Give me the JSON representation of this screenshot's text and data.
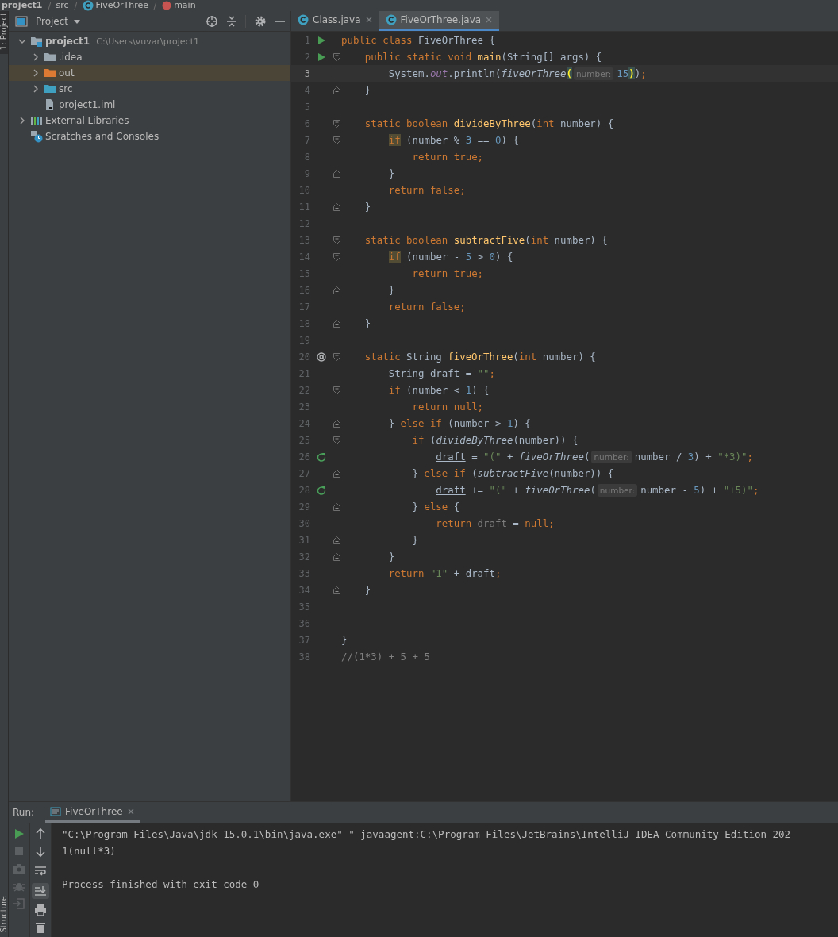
{
  "breadcrumbs": [
    {
      "label": "project1",
      "kind": "module"
    },
    {
      "label": "src",
      "kind": "folder"
    },
    {
      "label": "FiveOrThree",
      "kind": "class"
    },
    {
      "label": "main",
      "kind": "method"
    }
  ],
  "tool_strip": {
    "top": "1: Project",
    "bottom": "Structure"
  },
  "project_panel": {
    "title": "Project",
    "tools": [
      {
        "kind": "locate"
      },
      {
        "kind": "collapse"
      },
      {
        "kind": "settings"
      },
      {
        "kind": "hide"
      }
    ],
    "tree": [
      {
        "label": "project1",
        "path": "C:\\Users\\vuvar\\project1",
        "kind": "module",
        "expanded": true,
        "selected": false,
        "children": [
          {
            "label": ".idea",
            "kind": "folder",
            "expanded": false,
            "selected": false
          },
          {
            "label": "out",
            "kind": "excluded-folder",
            "expanded": false,
            "selected": true
          },
          {
            "label": "src",
            "kind": "source-folder",
            "expanded": false,
            "selected": false
          },
          {
            "label": "project1.iml",
            "kind": "module-file",
            "selected": false
          }
        ]
      },
      {
        "label": "External Libraries",
        "kind": "libraries",
        "expanded": false,
        "selected": false
      },
      {
        "label": "Scratches and Consoles",
        "kind": "scratches",
        "selected": false
      }
    ]
  },
  "editor": {
    "tabs": [
      {
        "label": "Class.java",
        "selected": false
      },
      {
        "label": "FiveOrThree.java",
        "selected": true
      }
    ],
    "lines": [
      {
        "number": "1",
        "current": false,
        "gutter_icon": {
          "kind": "run"
        },
        "tokens": [
          {
            "kind": "keyword",
            "text": "public class "
          },
          {
            "kind": "plain",
            "text": "FiveOrThree {"
          }
        ]
      },
      {
        "number": "2",
        "current": false,
        "gutter_icon": {
          "kind": "run"
        },
        "fold_marker": {
          "kind": "start"
        },
        "tokens": [
          {
            "kind": "keyword",
            "text": "    public static void "
          },
          {
            "kind": "declaration",
            "text": "main"
          },
          {
            "kind": "plain",
            "text": "(String[] args) {"
          }
        ]
      },
      {
        "number": "3",
        "current": true,
        "tokens": [
          {
            "kind": "plain",
            "text": "        System."
          },
          {
            "kind": "field",
            "text": "out"
          },
          {
            "kind": "plain",
            "text": ".println("
          },
          {
            "kind": "call",
            "text": "fiveOrThree"
          },
          {
            "kind": "brace-match",
            "text": "("
          },
          {
            "kind": "hint",
            "text": "number:"
          },
          {
            "kind": "number",
            "text": "15"
          },
          {
            "kind": "brace-match",
            "text": ")"
          },
          {
            "kind": "plain",
            "text": ")"
          },
          {
            "kind": "keyword",
            "text": ";"
          }
        ]
      },
      {
        "number": "4",
        "current": false,
        "fold_marker": {
          "kind": "end"
        },
        "tokens": [
          {
            "kind": "plain",
            "text": "    }"
          }
        ]
      },
      {
        "number": "5",
        "current": false
      },
      {
        "number": "6",
        "current": false,
        "fold_marker": {
          "kind": "start"
        },
        "tokens": [
          {
            "kind": "keyword",
            "text": "    static boolean "
          },
          {
            "kind": "declaration",
            "text": "divideByThree"
          },
          {
            "kind": "plain",
            "text": "("
          },
          {
            "kind": "keyword",
            "text": "int"
          },
          {
            "kind": "plain",
            "text": " number) {"
          }
        ]
      },
      {
        "number": "7",
        "current": false,
        "fold_marker": {
          "kind": "start"
        },
        "tokens": [
          {
            "kind": "keyword-match",
            "text": "        if"
          },
          {
            "kind": "plain",
            "text": " (number % "
          },
          {
            "kind": "number",
            "text": "3"
          },
          {
            "kind": "plain",
            "text": " == "
          },
          {
            "kind": "number",
            "text": "0"
          },
          {
            "kind": "plain",
            "text": ") {"
          }
        ]
      },
      {
        "number": "8",
        "current": false,
        "tokens": [
          {
            "kind": "keyword",
            "text": "            return true;"
          }
        ]
      },
      {
        "number": "9",
        "current": false,
        "fold_marker": {
          "kind": "end"
        },
        "tokens": [
          {
            "kind": "plain",
            "text": "        }"
          }
        ]
      },
      {
        "number": "10",
        "current": false,
        "tokens": [
          {
            "kind": "keyword",
            "text": "        return false;"
          }
        ]
      },
      {
        "number": "11",
        "current": false,
        "fold_marker": {
          "kind": "end"
        },
        "tokens": [
          {
            "kind": "plain",
            "text": "    }"
          }
        ]
      },
      {
        "number": "12",
        "current": false
      },
      {
        "number": "13",
        "current": false,
        "fold_marker": {
          "kind": "start"
        },
        "tokens": [
          {
            "kind": "keyword",
            "text": "    static boolean "
          },
          {
            "kind": "declaration",
            "text": "subtractFive"
          },
          {
            "kind": "plain",
            "text": "("
          },
          {
            "kind": "keyword",
            "text": "int"
          },
          {
            "kind": "plain",
            "text": " number) {"
          }
        ]
      },
      {
        "number": "14",
        "current": false,
        "fold_marker": {
          "kind": "start"
        },
        "tokens": [
          {
            "kind": "keyword-match",
            "text": "        if"
          },
          {
            "kind": "plain",
            "text": " (number - "
          },
          {
            "kind": "number",
            "text": "5"
          },
          {
            "kind": "plain",
            "text": " > "
          },
          {
            "kind": "number",
            "text": "0"
          },
          {
            "kind": "plain",
            "text": ") {"
          }
        ]
      },
      {
        "number": "15",
        "current": false,
        "tokens": [
          {
            "kind": "keyword",
            "text": "            return true;"
          }
        ]
      },
      {
        "number": "16",
        "current": false,
        "fold_marker": {
          "kind": "end"
        },
        "tokens": [
          {
            "kind": "plain",
            "text": "        }"
          }
        ]
      },
      {
        "number": "17",
        "current": false,
        "tokens": [
          {
            "kind": "keyword",
            "text": "        return false;"
          }
        ]
      },
      {
        "number": "18",
        "current": false,
        "fold_marker": {
          "kind": "end"
        },
        "tokens": [
          {
            "kind": "plain",
            "text": "    }"
          }
        ]
      },
      {
        "number": "19",
        "current": false
      },
      {
        "number": "20",
        "current": false,
        "gutter_icon": {
          "kind": "at"
        },
        "fold_marker": {
          "kind": "start"
        },
        "tokens": [
          {
            "kind": "keyword",
            "text": "    static "
          },
          {
            "kind": "plain",
            "text": "String "
          },
          {
            "kind": "declaration",
            "text": "fiveOrThree"
          },
          {
            "kind": "plain",
            "text": "("
          },
          {
            "kind": "keyword",
            "text": "int"
          },
          {
            "kind": "plain",
            "text": " number) {"
          }
        ]
      },
      {
        "number": "21",
        "current": false,
        "tokens": [
          {
            "kind": "plain",
            "text": "        String "
          },
          {
            "kind": "variable",
            "text": "draft"
          },
          {
            "kind": "plain",
            "text": " = "
          },
          {
            "kind": "string",
            "text": "\"\""
          },
          {
            "kind": "keyword",
            "text": ";"
          }
        ]
      },
      {
        "number": "22",
        "current": false,
        "fold_marker": {
          "kind": "start"
        },
        "tokens": [
          {
            "kind": "keyword",
            "text": "        if"
          },
          {
            "kind": "plain",
            "text": " (number < "
          },
          {
            "kind": "number",
            "text": "1"
          },
          {
            "kind": "plain",
            "text": ") {"
          }
        ]
      },
      {
        "number": "23",
        "current": false,
        "tokens": [
          {
            "kind": "keyword",
            "text": "            return null;"
          }
        ]
      },
      {
        "number": "24",
        "current": false,
        "fold_marker": {
          "kind": "end"
        },
        "tokens": [
          {
            "kind": "plain",
            "text": "        } "
          },
          {
            "kind": "keyword",
            "text": "else if"
          },
          {
            "kind": "plain",
            "text": " (number > "
          },
          {
            "kind": "number",
            "text": "1"
          },
          {
            "kind": "plain",
            "text": ") {"
          }
        ]
      },
      {
        "number": "25",
        "current": false,
        "fold_marker": {
          "kind": "start"
        },
        "tokens": [
          {
            "kind": "keyword",
            "text": "            if"
          },
          {
            "kind": "plain",
            "text": " ("
          },
          {
            "kind": "call",
            "text": "divideByThree"
          },
          {
            "kind": "plain",
            "text": "(number)) {"
          }
        ]
      },
      {
        "number": "26",
        "current": false,
        "gutter_icon": {
          "kind": "recursive"
        },
        "tokens": [
          {
            "kind": "variable",
            "text": "                draft"
          },
          {
            "kind": "plain",
            "text": " = "
          },
          {
            "kind": "string",
            "text": "\"(\""
          },
          {
            "kind": "plain",
            "text": " + "
          },
          {
            "kind": "call",
            "text": "fiveOrThree"
          },
          {
            "kind": "plain",
            "text": "("
          },
          {
            "kind": "hint",
            "text": "number:"
          },
          {
            "kind": "plain",
            "text": "number / "
          },
          {
            "kind": "number",
            "text": "3"
          },
          {
            "kind": "plain",
            "text": ") + "
          },
          {
            "kind": "string",
            "text": "\"*3)\""
          },
          {
            "kind": "keyword",
            "text": ";"
          }
        ]
      },
      {
        "number": "27",
        "current": false,
        "fold_marker": {
          "kind": "end"
        },
        "tokens": [
          {
            "kind": "plain",
            "text": "            } "
          },
          {
            "kind": "keyword",
            "text": "else if"
          },
          {
            "kind": "plain",
            "text": " ("
          },
          {
            "kind": "call",
            "text": "subtractFive"
          },
          {
            "kind": "plain",
            "text": "(number)) {"
          }
        ]
      },
      {
        "number": "28",
        "current": false,
        "gutter_icon": {
          "kind": "recursive"
        },
        "tokens": [
          {
            "kind": "variable",
            "text": "                draft"
          },
          {
            "kind": "plain",
            "text": " += "
          },
          {
            "kind": "string",
            "text": "\"(\""
          },
          {
            "kind": "plain",
            "text": " + "
          },
          {
            "kind": "call",
            "text": "fiveOrThree"
          },
          {
            "kind": "plain",
            "text": "("
          },
          {
            "kind": "hint",
            "text": "number:"
          },
          {
            "kind": "plain",
            "text": "number - "
          },
          {
            "kind": "number",
            "text": "5"
          },
          {
            "kind": "plain",
            "text": ") + "
          },
          {
            "kind": "string",
            "text": "\"+5)\""
          },
          {
            "kind": "keyword",
            "text": ";"
          }
        ]
      },
      {
        "number": "29",
        "current": false,
        "fold_marker": {
          "kind": "end"
        },
        "tokens": [
          {
            "kind": "plain",
            "text": "            } "
          },
          {
            "kind": "keyword",
            "text": "else"
          },
          {
            "kind": "plain",
            "text": " {"
          }
        ]
      },
      {
        "number": "30",
        "current": false,
        "tokens": [
          {
            "kind": "keyword",
            "text": "                return "
          },
          {
            "kind": "unused",
            "text": "draft"
          },
          {
            "kind": "plain",
            "text": " = "
          },
          {
            "kind": "keyword",
            "text": "null;"
          }
        ]
      },
      {
        "number": "31",
        "current": false,
        "fold_marker": {
          "kind": "end"
        },
        "tokens": [
          {
            "kind": "plain",
            "text": "            }"
          }
        ]
      },
      {
        "number": "32",
        "current": false,
        "fold_marker": {
          "kind": "end"
        },
        "tokens": [
          {
            "kind": "plain",
            "text": "        }"
          }
        ]
      },
      {
        "number": "33",
        "current": false,
        "tokens": [
          {
            "kind": "keyword",
            "text": "        return "
          },
          {
            "kind": "string",
            "text": "\"1\""
          },
          {
            "kind": "plain",
            "text": " + "
          },
          {
            "kind": "variable",
            "text": "draft"
          },
          {
            "kind": "keyword",
            "text": ";"
          }
        ]
      },
      {
        "number": "34",
        "current": false,
        "fold_marker": {
          "kind": "end"
        },
        "tokens": [
          {
            "kind": "plain",
            "text": "    }"
          }
        ]
      },
      {
        "number": "35",
        "current": false
      },
      {
        "number": "36",
        "current": false
      },
      {
        "number": "37",
        "current": false,
        "tokens": [
          {
            "kind": "plain",
            "text": "}"
          }
        ]
      },
      {
        "number": "38",
        "current": false,
        "tokens": [
          {
            "kind": "comment",
            "text": "//(1*3) + 5 + 5"
          }
        ]
      }
    ]
  },
  "run_panel": {
    "label": "Run:",
    "tabs": [
      {
        "label": "FiveOrThree",
        "selected": true
      }
    ],
    "run_tools": [
      {
        "kind": "run",
        "disabled": false
      },
      {
        "kind": "stop",
        "disabled": true
      },
      {
        "kind": "camera",
        "disabled": true
      },
      {
        "kind": "debug",
        "disabled": true
      },
      {
        "kind": "exit",
        "disabled": true
      }
    ],
    "console_tools": [
      {
        "kind": "up"
      },
      {
        "kind": "down"
      },
      {
        "kind": "wrap",
        "on": false
      },
      {
        "kind": "scroll-end",
        "on": true
      },
      {
        "kind": "print"
      },
      {
        "kind": "trash"
      }
    ],
    "output": [
      {
        "kind": "command",
        "text": "\"C:\\Program Files\\Java\\jdk-15.0.1\\bin\\java.exe\" \"-javaagent:C:\\Program Files\\JetBrains\\IntelliJ IDEA Community Edition 202"
      },
      {
        "kind": "stdout",
        "text": "1(null*3)"
      },
      {
        "kind": "status",
        "text": "Process finished with exit code 0"
      }
    ]
  }
}
